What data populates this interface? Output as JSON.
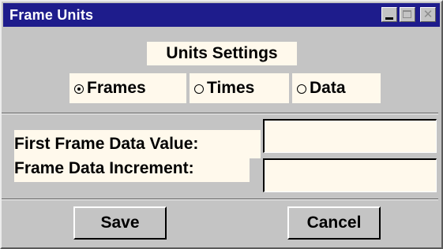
{
  "window": {
    "title": "Frame Units",
    "controls": [
      "minimize-icon",
      "maximize-icon",
      "close-icon"
    ]
  },
  "section_title": "Units Settings",
  "units": {
    "selected": "Frames",
    "options": [
      {
        "label": "Frames",
        "checked": true
      },
      {
        "label": "Times",
        "checked": false
      },
      {
        "label": "Data",
        "checked": false
      }
    ]
  },
  "fields": {
    "first_frame": {
      "label": "First Frame Data Value:",
      "value": ""
    },
    "increment": {
      "label": "Frame Data Increment:",
      "value": ""
    }
  },
  "buttons": {
    "save": "Save",
    "cancel": "Cancel"
  },
  "colors": {
    "titlebar": "#1e1c8c",
    "dialog_bg": "#c4c4c4",
    "label_bg": "#fff9ec"
  }
}
